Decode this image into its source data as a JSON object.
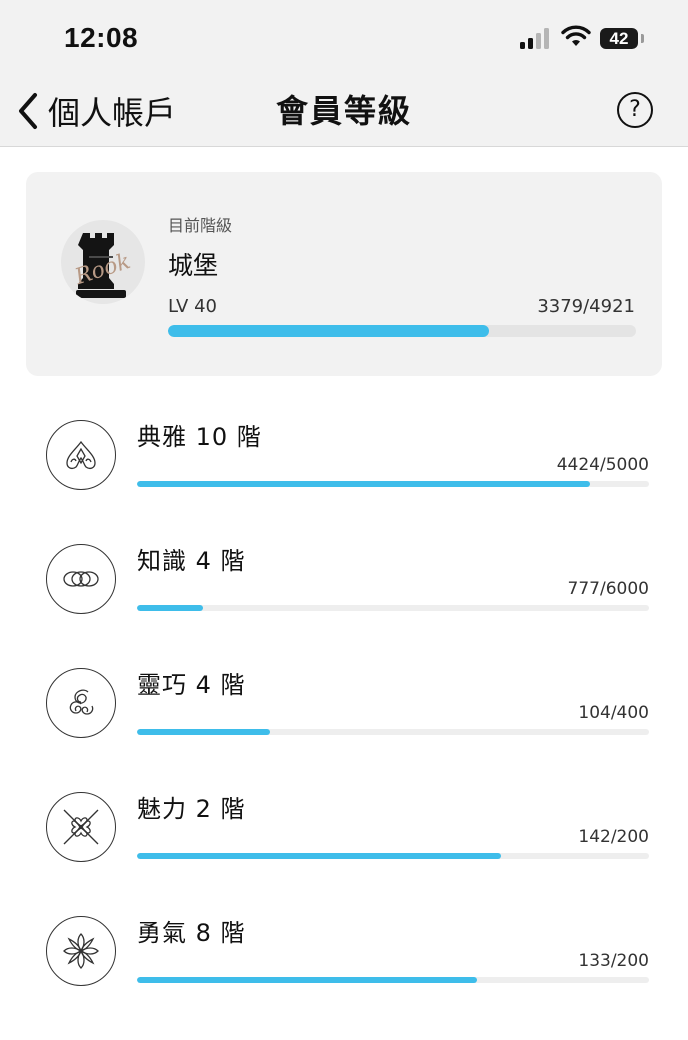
{
  "status_bar": {
    "time": "12:08",
    "battery": "42",
    "icons": [
      "cellular-signal-icon",
      "wifi-icon",
      "battery-icon"
    ]
  },
  "nav": {
    "back_label": "個人帳戶",
    "title": "會員等級",
    "help_label": "?",
    "icons": [
      "chevron-left-icon",
      "help-icon"
    ]
  },
  "current_level": {
    "caption": "目前階級",
    "tier": "城堡",
    "badge_text": "Rook",
    "badge_icon": "rook-chess-piece-icon",
    "level": "LV 40",
    "xp_text": "3379/4921",
    "progress": 0.6867
  },
  "stats": [
    {
      "label": "典雅 10 階",
      "value_text": "4424/5000",
      "progress": 0.8848,
      "icon": "elegance-drop-icon"
    },
    {
      "label": "知識 4 階",
      "value_text": "777/6000",
      "progress": 0.1295,
      "icon": "knowledge-rings-icon"
    },
    {
      "label": "靈巧 4 階",
      "value_text": "104/400",
      "progress": 0.26,
      "icon": "dexterity-swirl-icon"
    },
    {
      "label": "魅力 2 階",
      "value_text": "142/200",
      "progress": 0.71,
      "icon": "charm-cross-hearts-icon"
    },
    {
      "label": "勇氣 8 階",
      "value_text": "133/200",
      "progress": 0.665,
      "icon": "courage-flower-icon"
    }
  ],
  "colors": {
    "progress_fill": "#3ebdea",
    "progress_track": "#e4e4e4",
    "bar_background": "#f2f2f2"
  }
}
